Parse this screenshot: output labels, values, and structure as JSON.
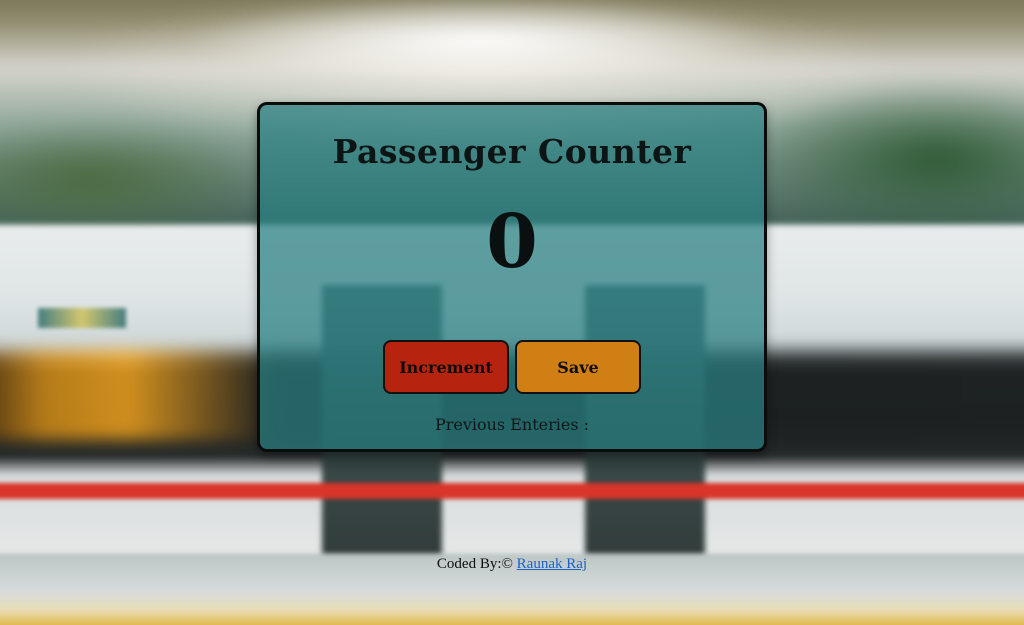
{
  "app": {
    "title": "Passenger Counter",
    "count": "0"
  },
  "buttons": {
    "increment_label": "Increment",
    "save_label": "Save"
  },
  "history": {
    "label": "Previous Enteries :",
    "entries": ""
  },
  "footer": {
    "prefix": "Coded By:© ",
    "author_link": "Raunak Raj"
  },
  "colors": {
    "card_bg": "#28807f",
    "increment_bg": "#b6240f",
    "save_bg": "#d07f15",
    "link": "#1a62c7"
  },
  "background": {
    "description_icon": "train-station-photo"
  }
}
